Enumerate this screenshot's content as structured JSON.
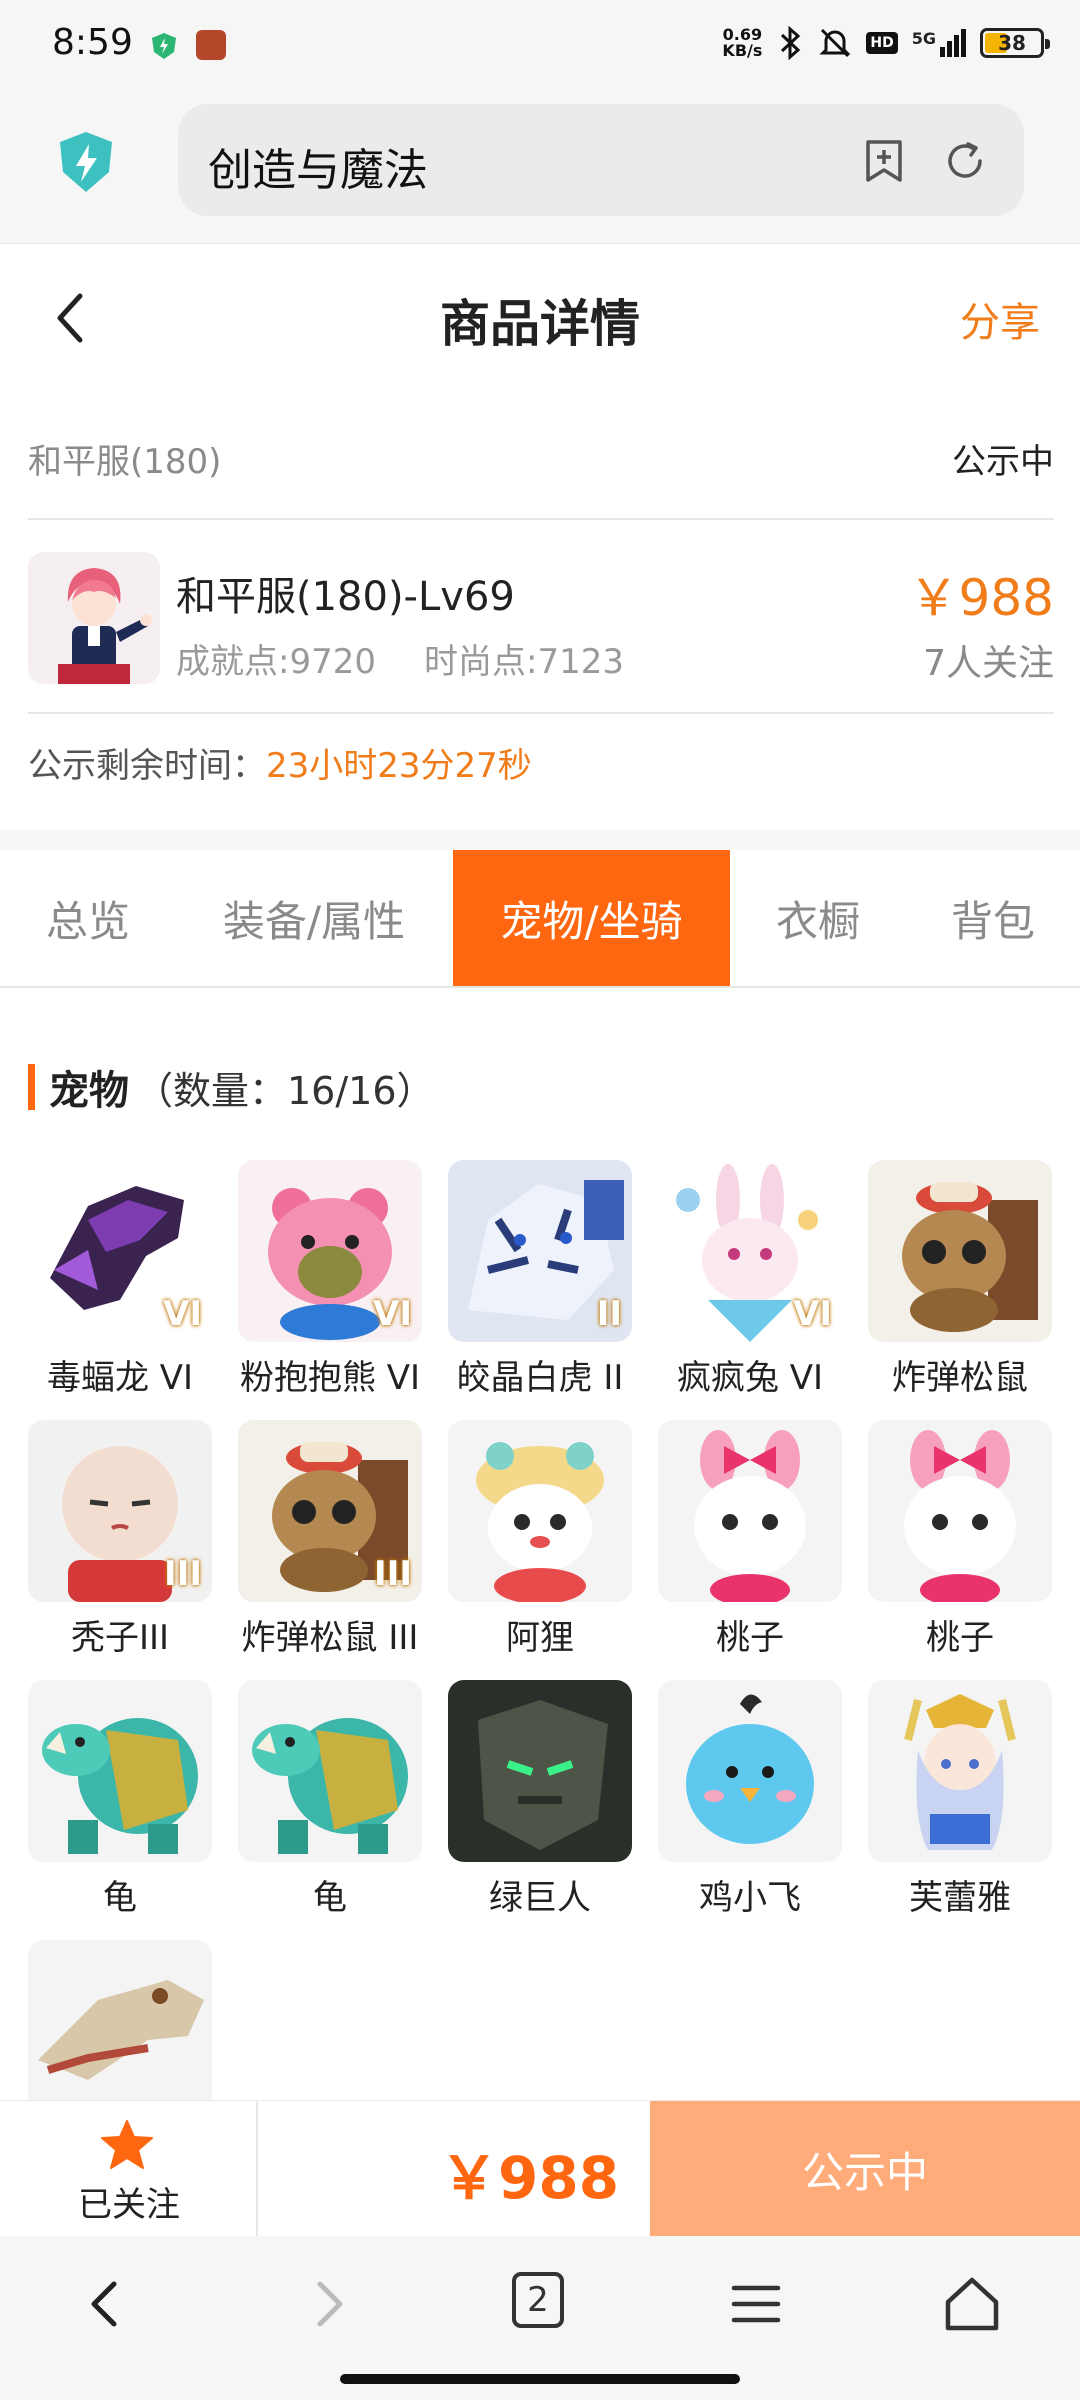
{
  "status_bar": {
    "time": "8:59",
    "net_speed_top": "0.69",
    "net_speed_bottom": "KB/s",
    "network": "5G",
    "hd": "HD",
    "battery": "38"
  },
  "browser": {
    "url_text": "创造与魔法"
  },
  "header": {
    "title": "商品详情",
    "share": "分享"
  },
  "listing": {
    "server": "和平服(180)",
    "status": "公示中",
    "product_name": "和平服(180)-Lv69",
    "achievement": "成就点:9720",
    "fashion": "时尚点:7123",
    "price": "￥988",
    "followers": "7人关注",
    "remain_label": "公示剩余时间：",
    "remain_value": "23小时23分27秒"
  },
  "tabs": [
    {
      "label": "总览",
      "active": false
    },
    {
      "label": "装备/属性",
      "active": false
    },
    {
      "label": "宠物/坐骑",
      "active": true
    },
    {
      "label": "衣橱",
      "active": false
    },
    {
      "label": "背包",
      "active": false
    }
  ],
  "pets_section": {
    "title": "宠物",
    "count": "（数量：16/16）",
    "items": [
      {
        "name": "毒蝠龙 VI",
        "badge": "VI",
        "icon": "dragon-icon"
      },
      {
        "name": "粉抱抱熊 VI",
        "badge": "VI",
        "icon": "bear-icon"
      },
      {
        "name": "皎晶白虎 II",
        "badge": "II",
        "icon": "tiger-icon"
      },
      {
        "name": "疯疯兔 VI",
        "badge": "VI",
        "icon": "rabbit-icon"
      },
      {
        "name": "炸弹松鼠",
        "badge": "",
        "icon": "squirrel-icon"
      },
      {
        "name": "秃子III",
        "badge": "III",
        "icon": "bald-head-icon"
      },
      {
        "name": "炸弹松鼠 III",
        "badge": "III",
        "icon": "squirrel-icon"
      },
      {
        "name": "阿狸",
        "badge": "",
        "icon": "fox-icon"
      },
      {
        "name": "桃子",
        "badge": "",
        "icon": "bunny-pink-icon"
      },
      {
        "name": "桃子",
        "badge": "",
        "icon": "bunny-pink-icon"
      },
      {
        "name": "龟",
        "badge": "",
        "icon": "turtle-icon"
      },
      {
        "name": "龟",
        "badge": "",
        "icon": "turtle-icon"
      },
      {
        "name": "绿巨人",
        "badge": "",
        "icon": "stone-giant-icon"
      },
      {
        "name": "鸡小飞",
        "badge": "",
        "icon": "chick-icon"
      },
      {
        "name": "芙蕾雅",
        "badge": "",
        "icon": "goddess-icon"
      },
      {
        "name": "",
        "badge": "",
        "icon": "crocodile-icon"
      }
    ]
  },
  "action_bar": {
    "follow_label": "已关注",
    "price": "￥988",
    "button": "公示中"
  },
  "nav_bar": {
    "tab_count": "2"
  },
  "colors": {
    "accent": "#ff6610",
    "price": "#f07c1a",
    "button_disabled": "#ffab7a"
  }
}
